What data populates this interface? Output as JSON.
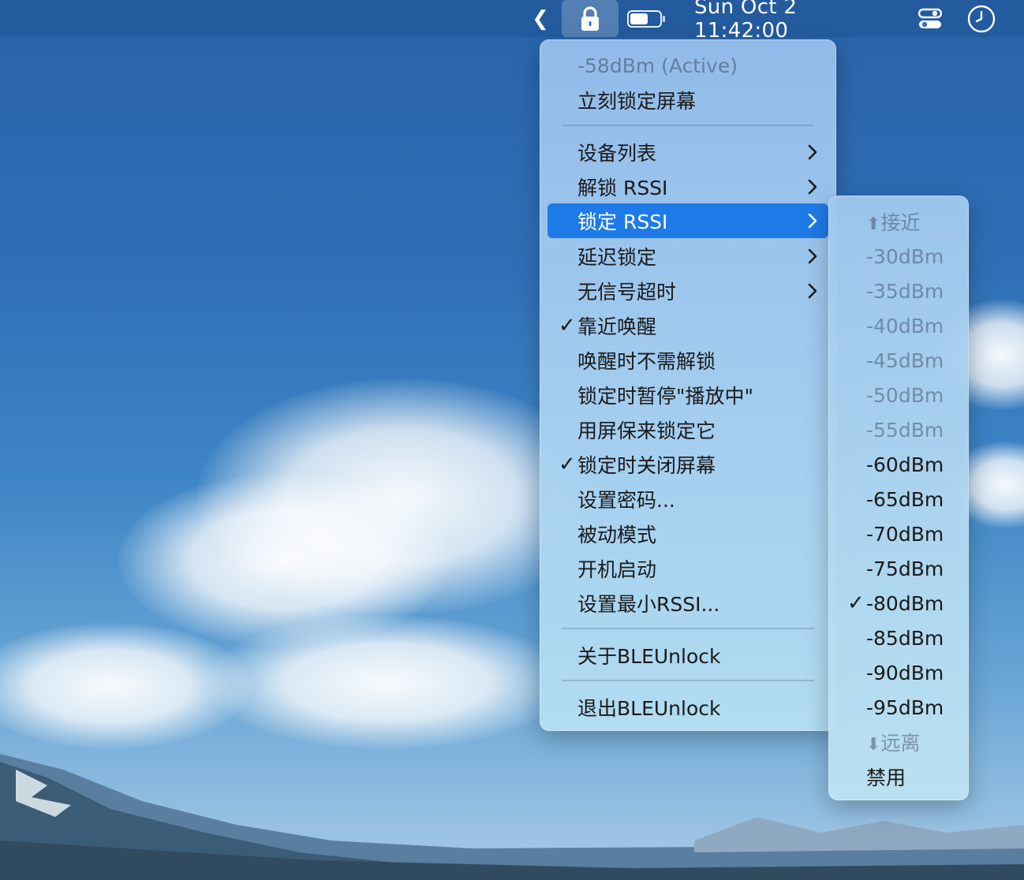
{
  "menubar": {
    "back_glyph": "❮",
    "lock_icon": "lock-icon",
    "battery_icon": "battery-icon",
    "datetime": "Sun Oct 2 11:42:00",
    "control_center_icon": "control-center-icon",
    "clock_icon": "clock-icon"
  },
  "main_menu": {
    "rssi_active": "-58dBm (Active)",
    "lock_now": "立刻锁定屏幕",
    "device_list": "设备列表",
    "unlock_rssi": "解锁 RSSI",
    "lock_rssi": "锁定 RSSI",
    "delay_lock": "延迟锁定",
    "no_signal_timeout": "无信号超时",
    "wake_on_proximity": "靠近唤醒",
    "wake_without_unlock": "唤醒时不需解锁",
    "pause_on_lock": "锁定时暂停\"播放中\"",
    "lock_with_screensaver": "用屏保来锁定它",
    "turn_off_screen": "锁定时关闭屏幕",
    "set_password": "设置密码...",
    "passive_mode": "被动模式",
    "launch_at_login": "开机启动",
    "set_min_rssi": "设置最小RSSI...",
    "about": "关于BLEUnlock",
    "quit": "退出BLEUnlock",
    "check_glyph": "✓"
  },
  "sub_menu": {
    "closer": "接近",
    "closer_glyph": "⬆",
    "items": [
      "-30dBm",
      "-35dBm",
      "-40dBm",
      "-45dBm",
      "-50dBm",
      "-55dBm",
      "-60dBm",
      "-65dBm",
      "-70dBm",
      "-75dBm",
      "-80dBm",
      "-85dBm",
      "-90dBm",
      "-95dBm"
    ],
    "farther": "远离",
    "farther_glyph": "⬇",
    "disable": "禁用",
    "selected_value": "-80dBm",
    "check_glyph": "✓"
  },
  "colors": {
    "highlight": "#1e7ae6"
  }
}
